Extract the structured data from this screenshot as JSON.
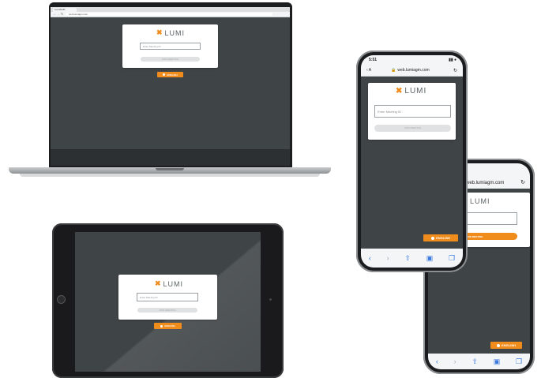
{
  "app": {
    "brand": "LUMI",
    "meeting_id_placeholder": "Enter Meeting ID",
    "join_label": "JOIN MEETING",
    "language_label": "ENGLISH"
  },
  "browser": {
    "tab_title": "LumiAGM",
    "address": "web.lumiagm.com"
  },
  "phone": {
    "time": "5:51",
    "back_label": "‹ A",
    "address": "web.lumiagm.com"
  },
  "colors": {
    "accent": "#f08c1c",
    "screen_bg": "#3f4446",
    "card_bg": "#ffffff",
    "join_disabled": "#dfe1e2"
  },
  "icons": {
    "logo": "x-logo-icon",
    "language": "globe-icon",
    "reload": "reload-icon",
    "lock": "lock-icon",
    "back": "back-icon",
    "forward": "forward-icon",
    "share": "share-icon",
    "bookmarks": "bookmarks-icon",
    "tabs": "tabs-icon"
  }
}
